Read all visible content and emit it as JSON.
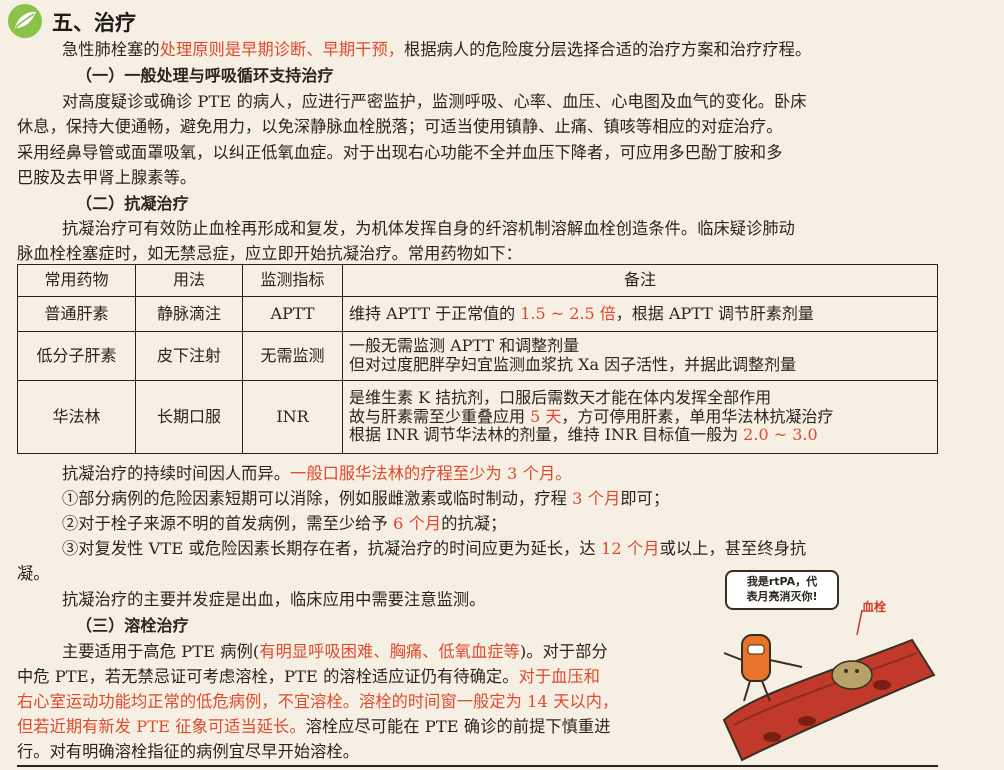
{
  "section": {
    "title": "五、治疗"
  },
  "intro": {
    "p1": "急性肺栓塞的",
    "p2": "处理原则是早期诊断、早期干预，",
    "p3": "根据病人的危险度分层选择合适的治疗方案和治疗疗程。"
  },
  "sub1": {
    "heading": "（一）一般处理与呼吸循环支持治疗",
    "l1": "对高度疑诊或确诊 PTE 的病人，应进行严密监护，监测呼吸、心率、血压、心电图及血气的变化。卧床",
    "l2": "休息，保持大便通畅，避免用力，以免深静脉血栓脱落；可适当使用镇静、止痛、镇咳等相应的对症治疗。",
    "l3": "采用经鼻导管或面罩吸氧，以纠正低氧血症。对于出现右心功能不全并血压下降者，可应用多巴酚丁胺和多",
    "l4": "巴胺及去甲肾上腺素等。"
  },
  "sub2": {
    "heading": "（二）抗凝治疗",
    "l1": "抗凝治疗可有效防止血栓再形成和复发，为机体发挥自身的纤溶机制溶解血栓创造条件。临床疑诊肺动",
    "l2": "脉血栓栓塞症时，如无禁忌症，应立即开始抗凝治疗。常用药物如下："
  },
  "table": {
    "headers": [
      "常用药物",
      "用法",
      "监测指标",
      "备注"
    ],
    "rows": [
      {
        "drug": "普通肝素",
        "usage": "静脉滴注",
        "monitor": "APTT",
        "note_a": "维持 APTT 于正常值的 ",
        "note_b": "1.5 ~ 2.5 倍",
        "note_c": "，根据 APTT 调节肝素剂量"
      },
      {
        "drug": "低分子肝素",
        "usage": "皮下注射",
        "monitor": "无需监测",
        "note_l1": "一般无需监测 APTT 和调整剂量",
        "note_l2": "但对过度肥胖孕妇宜监测血浆抗 Xa 因子活性，并据此调整剂量"
      },
      {
        "drug": "华法林",
        "usage": "长期口服",
        "monitor": "INR",
        "note_l1": "是维生素 K 拮抗剂，口服后需数天才能在体内发挥全部作用",
        "note_l2a": "故与肝素需至少重叠应用 ",
        "note_l2b": "5 天",
        "note_l2c": "，方可停用肝素，单用华法林抗凝治疗",
        "note_l3a": "根据 INR 调节华法林的剂量，维持 INR 目标值一般为 ",
        "note_l3b": "2.0 ~ 3.0"
      }
    ]
  },
  "duration": {
    "l1a": "抗凝治疗的持续时间因人而异。",
    "l1b": "一般口服华法林的疗程至少为 3 个月。",
    "i1a": "①部分病例的危险因素短期可以消除，例如服雌激素或临时制动，疗程 ",
    "i1b": "3 个月",
    "i1c": "即可；",
    "i2a": "②对于栓子来源不明的首发病例，需至少给予 ",
    "i2b": "6 个月",
    "i2c": "的抗凝；",
    "i3a": "③对复发性 VTE 或危险因素长期存在者，抗凝治疗的时间应更为延长，达 ",
    "i3b": "12 个月",
    "i3c": "或以上，甚至终身抗",
    "i3d": "凝。",
    "bleed": "抗凝治疗的主要并发症是出血，临床应用中需要注意监测。"
  },
  "sub3": {
    "heading": "（三）溶栓治疗",
    "l1a": "主要适用于高危 PTE 病例(",
    "l1b": "有明显呼吸困难、胸痛、低氧血症等",
    "l1c": ")。对于部分",
    "l2": "中危 PTE，若无禁忌证可考虑溶栓，PTE 的溶栓适应证仍有待确定。",
    "l2b": "对于血压和",
    "l3": "右心室运动功能均正常的低危病例，不宜溶栓。溶栓的时间窗一般定为 14 天以内，",
    "l4a": "但若近期有新发 PTE 征象可适当延长。",
    "l4b": "溶栓应尽可能在 PTE 确诊的前提下慎重进",
    "l5": "行。对有明确溶栓指征的病例宜尽早开始溶栓。"
  },
  "illustration": {
    "bubble_l1": "我是rtPA，代",
    "bubble_l2": "表月亮消灭你!",
    "clot_label": "血栓"
  },
  "colors": {
    "accent_red": "#e0492e",
    "paper": "#f5f0e3",
    "logo_green": "#8bc34a"
  }
}
